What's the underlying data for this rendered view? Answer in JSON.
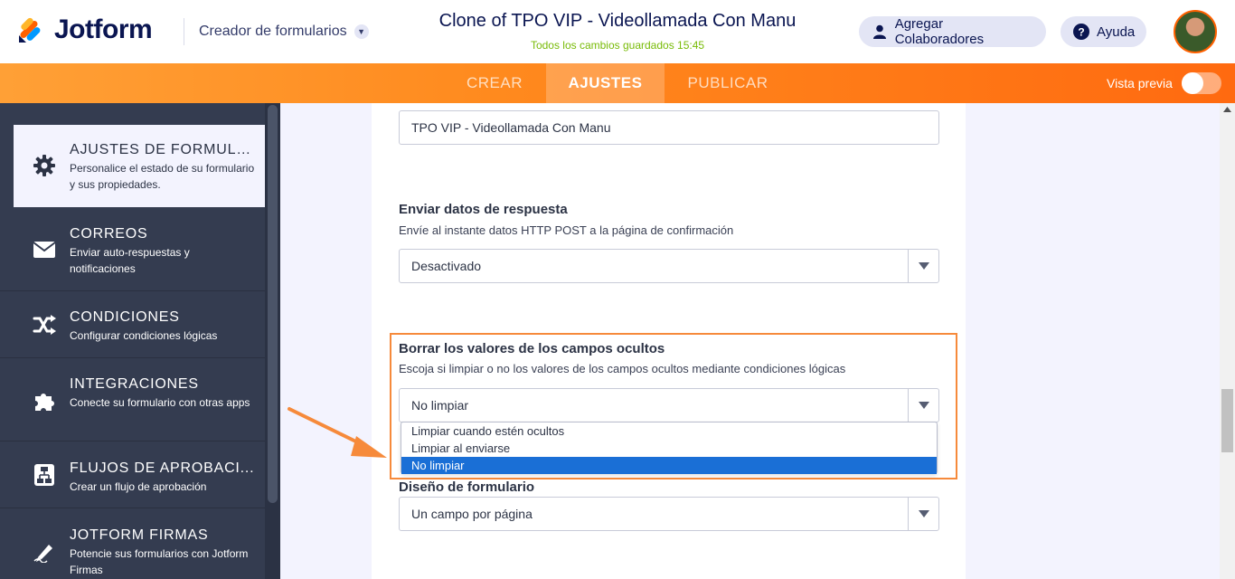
{
  "header": {
    "brand": "Jotform",
    "builder_label": "Creador de formularios",
    "form_title": "Clone of TPO VIP - Videollamada Con Manu",
    "save_status": "Todos los cambios guardados 15:45",
    "collaborators_label": "Agregar Colaboradores",
    "help_label": "Ayuda"
  },
  "nav": {
    "tabs": [
      {
        "label": "CREAR"
      },
      {
        "label": "AJUSTES"
      },
      {
        "label": "PUBLICAR"
      }
    ],
    "active_tab": "AJUSTES",
    "preview_label": "Vista previa",
    "preview_enabled": false
  },
  "sidebar": {
    "items": [
      {
        "icon": "gear-icon",
        "title": "AJUSTES DE FORMULA...",
        "desc": "Personalice el estado de su formulario y sus propiedades."
      },
      {
        "icon": "envelope-icon",
        "title": "CORREOS",
        "desc": "Enviar auto-respuestas y notificaciones"
      },
      {
        "icon": "shuffle-icon",
        "title": "CONDICIONES",
        "desc": "Configurar condiciones lógicas"
      },
      {
        "icon": "puzzle-icon",
        "title": "INTEGRACIONES",
        "desc": "Conecte su formulario con otras apps"
      },
      {
        "icon": "workflow-icon",
        "title": "FLUJOS DE APROBACI...",
        "desc": "Crear un flujo de aprobación"
      },
      {
        "icon": "signature-pen-icon",
        "title": "JOTFORM FIRMAS",
        "desc": "Potencie sus formularios con Jotform Firmas"
      }
    ]
  },
  "main": {
    "title_field_value": "TPO VIP - Videollamada Con Manu",
    "send_post": {
      "label": "Enviar datos de respuesta",
      "desc": "Envíe al instante datos HTTP POST a la página de confirmación",
      "value": "Desactivado"
    },
    "clear_hidden": {
      "label": "Borrar los valores de los campos ocultos",
      "desc": "Escoja si limpiar o no los valores de los campos ocultos mediante condiciones lógicas",
      "value": "No limpiar",
      "options": [
        "Limpiar cuando estén ocultos",
        "Limpiar al enviarse",
        "No limpiar"
      ]
    },
    "form_layout": {
      "label": "Diseño de formulario",
      "value": "Un campo por página"
    }
  },
  "colors": {
    "accent_orange": "#ff6100",
    "nav_gradient_start": "#ffa036",
    "sidebar_bg": "#343c50",
    "selected_option": "#1a6fd6",
    "highlight_border": "#f68a3b",
    "saved_green": "#78bb07"
  }
}
